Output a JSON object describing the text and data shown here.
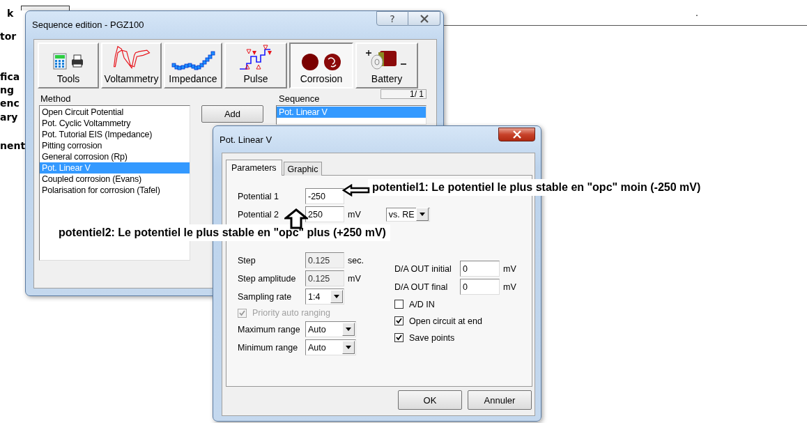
{
  "background": {
    "fragments": [
      "k",
      "tor",
      "fica",
      "ng",
      "enc",
      "ary",
      "nent"
    ],
    "mark": "."
  },
  "main_window": {
    "title": "Sequence edition - PGZ100",
    "help": "?",
    "tabs": [
      {
        "label": "Tools",
        "selected": false
      },
      {
        "label": "Voltammetry",
        "selected": false
      },
      {
        "label": "Impedance",
        "selected": false
      },
      {
        "label": "Pulse",
        "selected": false
      },
      {
        "label": "Corrosion",
        "selected": true
      },
      {
        "label": "Battery",
        "selected": false
      }
    ],
    "method_label": "Method",
    "methods": [
      {
        "label": "Open Circuit Potential",
        "selected": false
      },
      {
        "label": "Pot. Cyclic Voltammetry",
        "selected": false
      },
      {
        "label": "Pot. Tutorial EIS (Impedance)",
        "selected": false
      },
      {
        "label": "Pitting corrosion",
        "selected": false
      },
      {
        "label": "General corrosion (Rp)",
        "selected": false
      },
      {
        "label": "Pot. Linear V",
        "selected": true
      },
      {
        "label": "Coupled  corrosion (Evans)",
        "selected": false
      },
      {
        "label": "Polarisation for corrosion (Tafel)",
        "selected": false
      }
    ],
    "add_button": "Add",
    "sequence_label": "Sequence",
    "sequence_counter": "1/ 1",
    "sequence": [
      {
        "label": "Pot. Linear V",
        "selected": true
      }
    ]
  },
  "dialog": {
    "title": "Pot. Linear V",
    "tabs": [
      {
        "label": "Parameters",
        "selected": true
      },
      {
        "label": "Graphic",
        "selected": false
      }
    ],
    "left_fields": [
      {
        "kind": "input",
        "label": "Potential 1",
        "value": "-250",
        "disabled": false
      },
      {
        "kind": "input",
        "label": "Potential 2",
        "value": "250",
        "unit": "mV",
        "reference": "vs. RE",
        "disabled": false
      },
      {
        "kind": "input",
        "label": "Step",
        "value": "0.125",
        "unit": "sec.",
        "disabled": true
      },
      {
        "kind": "input",
        "label": "Step amplitude",
        "value": "0.125",
        "unit": "mV",
        "disabled": true
      },
      {
        "kind": "dropdown",
        "label": "Sampling rate",
        "value": "1:4"
      },
      {
        "kind": "checkbox",
        "label": "Priority auto ranging",
        "checked": true,
        "disabled": true
      },
      {
        "kind": "dropdown",
        "label": "Maximum range",
        "value": "Auto"
      },
      {
        "kind": "dropdown",
        "label": "Minimum range",
        "value": "Auto"
      }
    ],
    "right_fields": [
      {
        "kind": "input",
        "label": "D/A OUT initial",
        "value": "0",
        "unit": "mV",
        "disabled": false
      },
      {
        "kind": "input",
        "label": "D/A OUT final",
        "value": "0",
        "unit": "mV",
        "disabled": false
      },
      {
        "kind": "checkbox",
        "label": "A/D IN",
        "checked": false,
        "disabled": false
      },
      {
        "kind": "checkbox",
        "label": "Open circuit at end",
        "checked": true,
        "disabled": false
      },
      {
        "kind": "checkbox",
        "label": "Save points",
        "checked": true,
        "disabled": false
      }
    ],
    "buttons": [
      "OK",
      "Annuler"
    ]
  },
  "annotations": [
    {
      "text": "potentiel1: Le potentiel  le plus stable en \"opc\" moin (-250 mV)"
    },
    {
      "text": "potentiel2: Le potentiel  le plus stable en \"opc\" plus (+250 mV)"
    }
  ]
}
